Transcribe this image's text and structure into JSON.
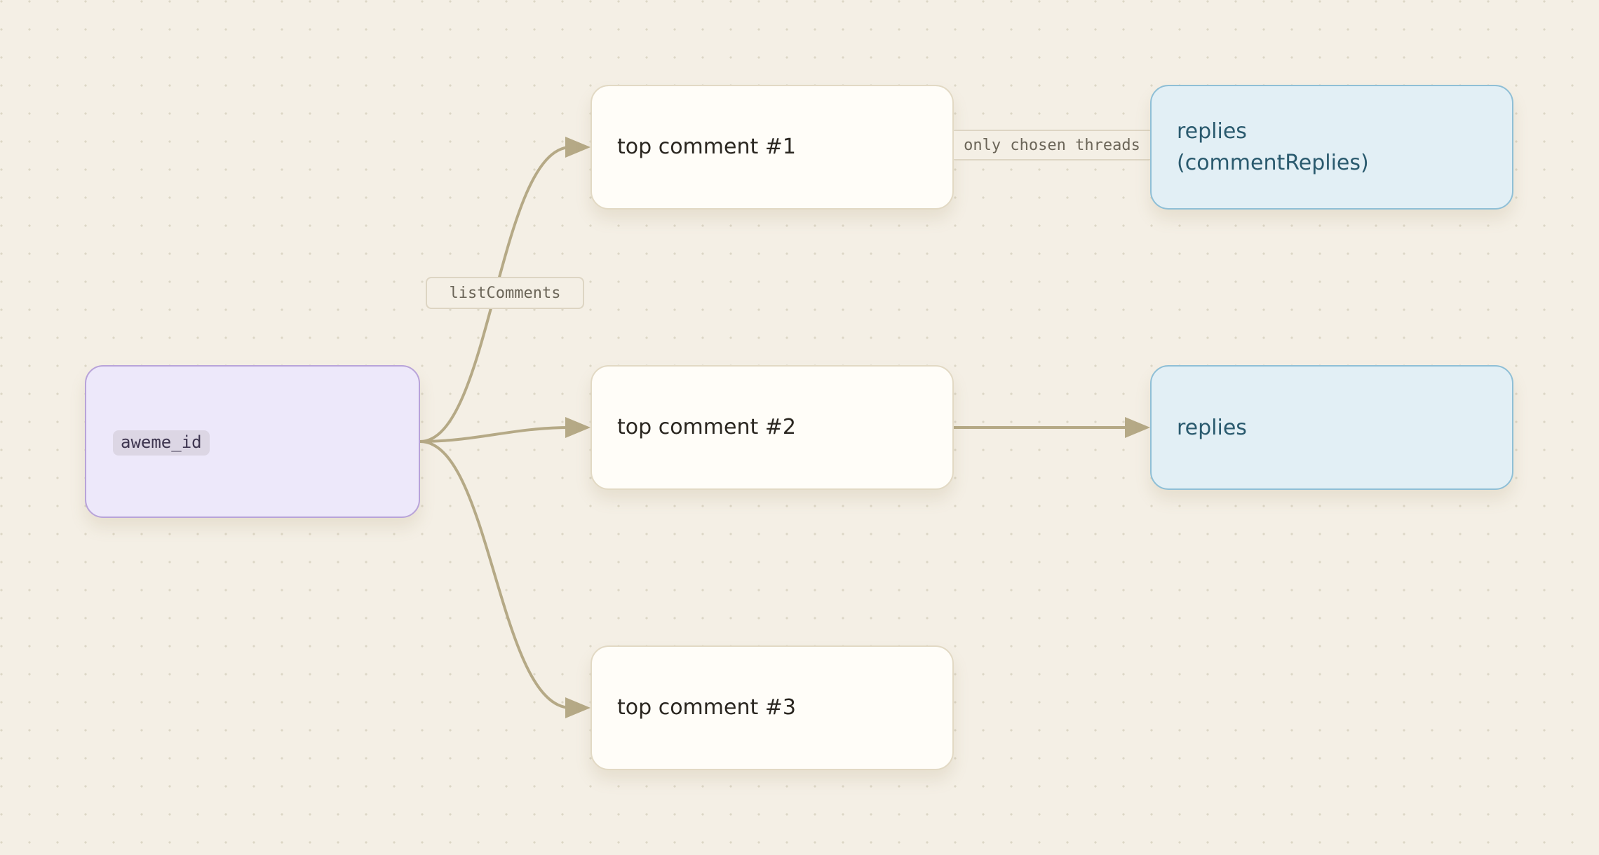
{
  "diagram": {
    "source_node": {
      "label": "aweme_id"
    },
    "edge_labels": {
      "list_comments": "listComments",
      "chosen_threads": "only chosen threads"
    },
    "comments": [
      {
        "label": "top comment #1"
      },
      {
        "label": "top comment #2"
      },
      {
        "label": "top comment #3"
      }
    ],
    "replies": [
      {
        "line1": "replies",
        "line2": "(commentReplies)"
      },
      {
        "line1": "replies"
      }
    ]
  },
  "colors": {
    "background": "#f4efe5",
    "edge": "#b5a986",
    "source_fill": "#ede8fa",
    "source_border": "#b8a3d9",
    "comment_fill": "#fffdf8",
    "comment_border": "#e2d9c4",
    "reply_fill": "#e2eff5",
    "reply_border": "#8fbfd6",
    "reply_text": "#2a5a6e"
  }
}
